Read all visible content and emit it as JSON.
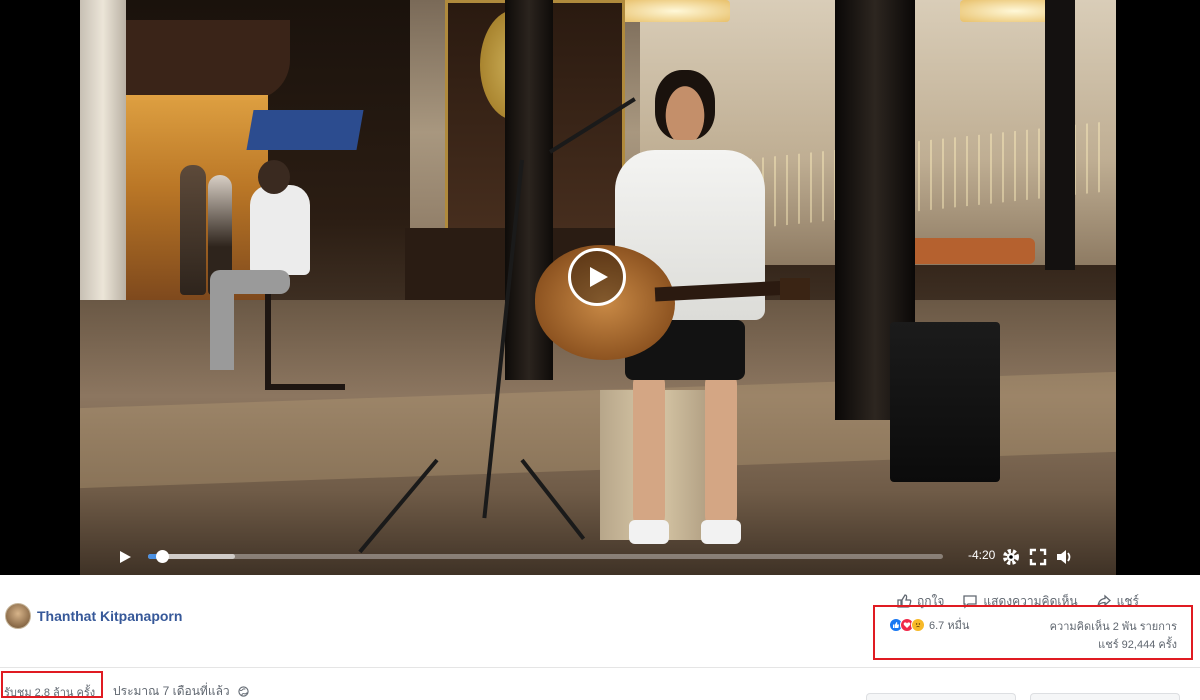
{
  "video": {
    "time_remaining": "-4:20",
    "progress_fraction": 0.017,
    "buffered_fraction": 0.11,
    "icons": [
      "play-icon",
      "gear-icon",
      "fullscreen-icon",
      "volume-icon"
    ]
  },
  "actions": {
    "like": "ถูกใจ",
    "comment": "แสดงความคิดเห็น",
    "share": "แชร์"
  },
  "post": {
    "author": "Thanthat Kitpanaporn",
    "reaction_count": "6.7 หมื่น",
    "reactions": [
      "like",
      "love",
      "sad"
    ],
    "comments": "ความคิดเห็น 2 พัน รายการ",
    "shares": "แชร์ 92,444 ครั้ง",
    "views": "รับชม 2.8 ล้าน ครั้ง",
    "time_ago": "ประมาณ 7 เดือนที่แล้ว",
    "privacy_icon": "globe-icon"
  },
  "colors": {
    "link": "#365899",
    "highlight": "#e01b22",
    "progress": "#4a90e2",
    "like": "#1877f2",
    "love": "#f02849",
    "sad": "#f7b928"
  }
}
